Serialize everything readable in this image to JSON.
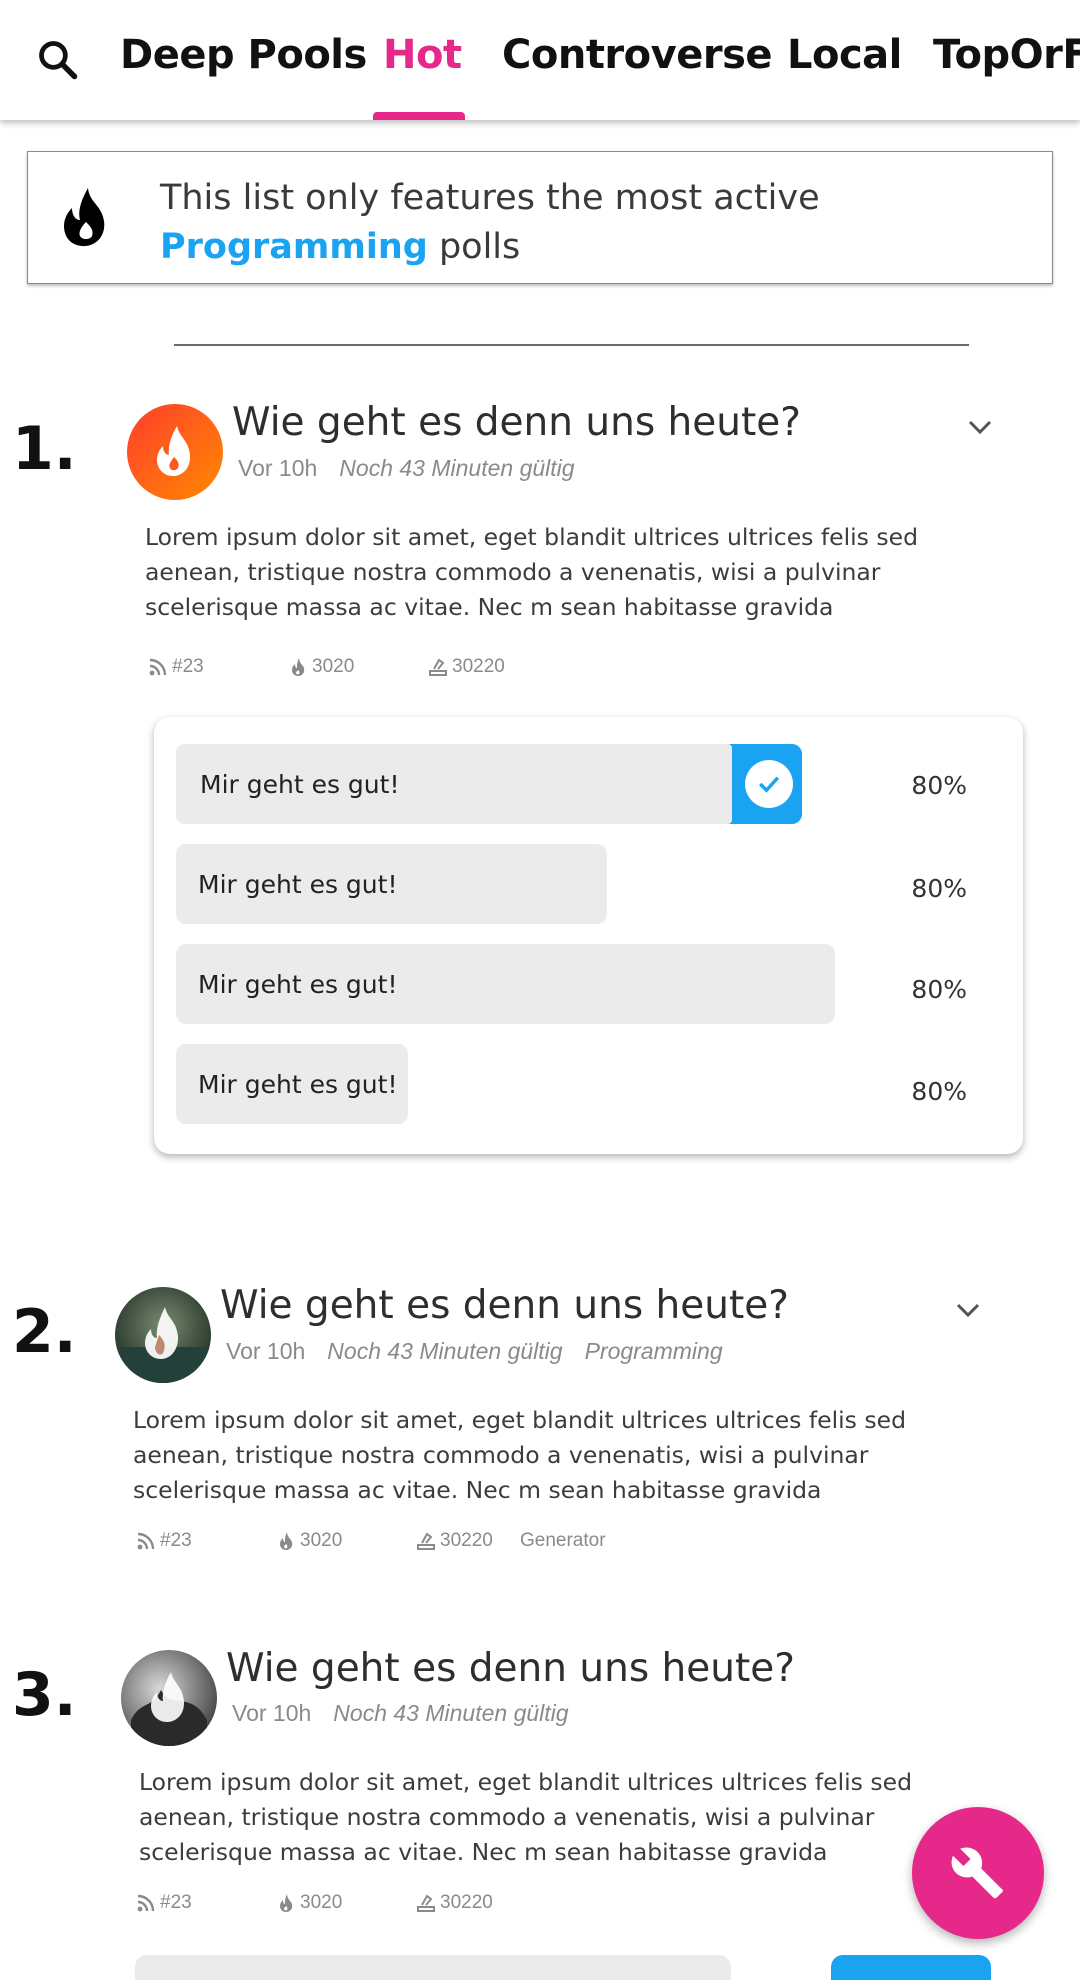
{
  "tabs": [
    {
      "label": "Deep Pools"
    },
    {
      "label": "Hot",
      "active": true
    },
    {
      "label": "Controverse"
    },
    {
      "label": "Local"
    },
    {
      "label": "TopOrFl"
    }
  ],
  "banner": {
    "text_before": "This list only features the most active ",
    "highlight": "Programming",
    "text_after": " polls"
  },
  "posts": [
    {
      "rank": "1.",
      "title": "Wie geht es denn uns heute?",
      "age": "Vor 10h",
      "validity": "Noch 43 Minuten gültig",
      "category": "",
      "body": "Lorem ipsum dolor sit amet, eget blandit ultrices ultrices felis sed aenean, tristique nostra commodo a venenatis, wisi a pulvinar scelerisque massa ac vitae. Nec m sean habitasse gravida",
      "stat_hash": "#23",
      "stat_hot": "3020",
      "stat_votes": "30220",
      "stat_extra": "",
      "poll": [
        {
          "label": "Mir geht es gut!",
          "percent": "80%",
          "selected": true
        },
        {
          "label": "Mir geht es gut!",
          "percent": "80%"
        },
        {
          "label": "Mir geht es gut!",
          "percent": "80%"
        },
        {
          "label": "Mir geht es gut!",
          "percent": "80%"
        }
      ]
    },
    {
      "rank": "2.",
      "title": "Wie geht es denn uns heute?",
      "age": "Vor 10h",
      "validity": "Noch 43 Minuten gültig",
      "category": "Programming",
      "body": "Lorem ipsum dolor sit amet, eget blandit ultrices ultrices felis sed aenean, tristique nostra commodo a venenatis, wisi a pulvinar scelerisque massa ac vitae. Nec m sean habitasse gravida",
      "stat_hash": "#23",
      "stat_hot": "3020",
      "stat_votes": "30220",
      "stat_extra": "Generator"
    },
    {
      "rank": "3.",
      "title": "Wie geht es denn uns heute?",
      "age": "Vor 10h",
      "validity": "Noch 43 Minuten gültig",
      "category": "",
      "body": "Lorem ipsum dolor sit amet, eget blandit ultrices ultrices felis sed aenean, tristique nostra commodo a venenatis, wisi a pulvinar scelerisque massa ac vitae. Nec m sean habitasse gravida",
      "stat_hash": "#23",
      "stat_hot": "3020",
      "stat_votes": "30220",
      "stat_extra": ""
    }
  ],
  "colors": {
    "accent": "#e6288a",
    "link": "#1aa3f0",
    "avatar_gradient_start": "#ff3d2e",
    "avatar_gradient_end": "#ff8a00"
  },
  "icons": [
    "search-icon",
    "flame-icon",
    "chevron-down-icon",
    "rss-icon",
    "check-icon",
    "vote-icon",
    "wrench-icon"
  ]
}
